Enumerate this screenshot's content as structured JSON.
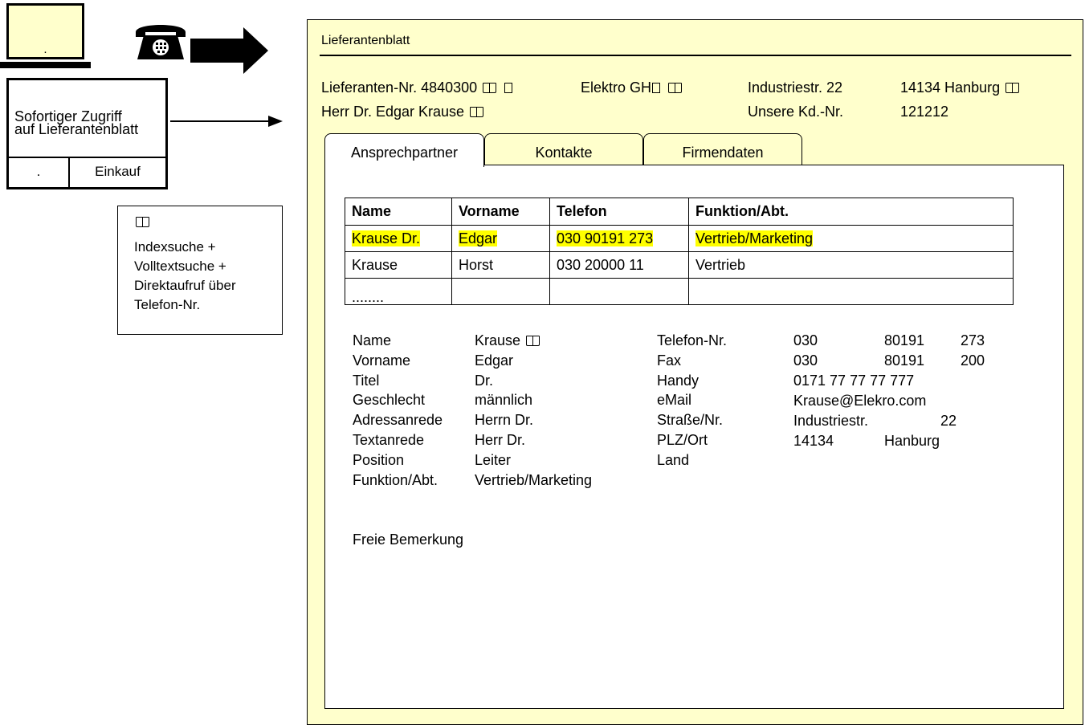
{
  "left": {
    "monitor_label": ".",
    "access_text_line1": "Sofortiger Zugriff",
    "access_text_line2": "auf Lieferantenblatt",
    "access_left": ".",
    "access_right": "Einkauf",
    "search_lines": [
      "Indexsuche +",
      "Volltextsuche +",
      "Direktaufruf über",
      "Telefon-Nr."
    ]
  },
  "window": {
    "title": "Lieferantenblatt",
    "supplier_no_label": "Lieferanten-Nr.",
    "supplier_no": "4840300",
    "company": "Elektro GH",
    "street": "Industriestr. 22",
    "zip_city": "14134  Hanburg",
    "contact_person": "Herr Dr. Edgar Krause",
    "customer_no_label": "Unsere Kd.-Nr.",
    "customer_no": "121212"
  },
  "tabs": [
    "Ansprechpartner",
    "Kontakte",
    "Firmendaten"
  ],
  "table": {
    "headers": [
      "Name",
      "Vorname",
      "Telefon",
      "Funktion/Abt."
    ],
    "rows": [
      [
        "Krause Dr.",
        "Edgar",
        "030 90191 273",
        "Vertrieb/Marketing"
      ],
      [
        "Krause",
        "Horst",
        "030 20000 11",
        "Vertrieb"
      ],
      [
        "........",
        "",
        "",
        ""
      ]
    ]
  },
  "details": {
    "left_labels": [
      "Name",
      "Vorname",
      "Titel",
      "Geschlecht",
      "Adressanrede",
      "Textanrede",
      "Position",
      "Funktion/Abt."
    ],
    "left_values": [
      "Krause",
      "Edgar",
      "Dr.",
      "männlich",
      "Herrn Dr.",
      "Herr Dr.",
      "Leiter",
      "Vertrieb/Marketing"
    ],
    "right_labels": [
      "Telefon-Nr.",
      "Fax",
      "Handy",
      "eMail",
      "Straße/Nr.",
      "PLZ/Ort",
      "Land"
    ],
    "phone": [
      "030",
      "80191",
      "273"
    ],
    "fax": [
      "030",
      "80191",
      "200"
    ],
    "mobile": "0171 77 77 77 777",
    "email": "Krause@Elekro.com",
    "street": [
      "Industriestr.",
      "22"
    ],
    "zip_city": [
      "14134",
      "Hanburg"
    ],
    "remarks_label": "Freie Bemerkung"
  }
}
